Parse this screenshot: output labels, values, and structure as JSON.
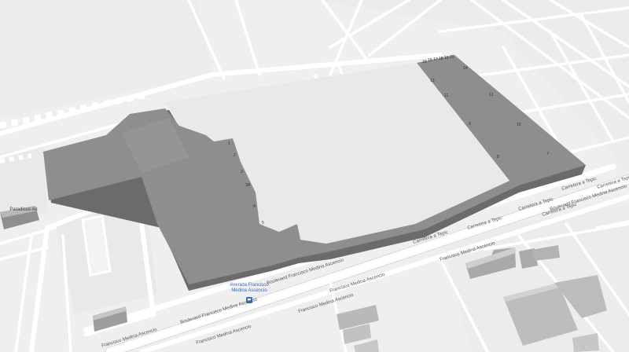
{
  "map": {
    "colors": {
      "background": "#efefef",
      "road": "#ffffff",
      "building_top": "#8e8e8e",
      "building_side": "#6b6b6b",
      "building_light": "#cfcfcf",
      "block_fill": "#e8e8e8",
      "transit_icon": "#2a6fd1"
    },
    "poi": {
      "name_line1": "Avenida Francisco",
      "name_line2": "Medina Ascencio",
      "icon": "bus-station-icon"
    },
    "place_labels": {
      "west": "Paradisus Air"
    },
    "street_labels": {
      "blvd_1": "Boulevard Francisco Medina Ascencio",
      "blvd_2": "Boulevard Francisco Medina Ascencio",
      "avenida_1": "Francisco Medina Ascencio",
      "avenida_2": "Francisco Medina Ascencio",
      "avenida_3": "Francisco Medina Ascencio",
      "avenida_4": "Francisco Medina Ascencio",
      "avenida_5": "Francisco Medina Ascencio",
      "carretera_1": "Carretera a Tepic",
      "carretera_2": "Carretera a Tepic",
      "carretera_3": "Carretera a Tepic",
      "carretera_4": "Carretera a Tepic",
      "carretera_5": "Carretera a Tepic",
      "carretera_6": "Carretera a Tepic",
      "blvd_3": "Boulevard Francisco Medina Ascencio"
    },
    "building_numbers": {
      "w1": "1",
      "w2": "2",
      "w3": "3",
      "w4": "3A",
      "w5": "4",
      "w6": "5",
      "e1": "14",
      "e2": "13",
      "e3": "12",
      "e4": "11",
      "e5": "10",
      "e6": "9",
      "e7": "8",
      "e8": "7",
      "e9": "16",
      "e10": "15",
      "e11": "17",
      "e12": "18",
      "e13": "19",
      "e14": "20"
    }
  }
}
